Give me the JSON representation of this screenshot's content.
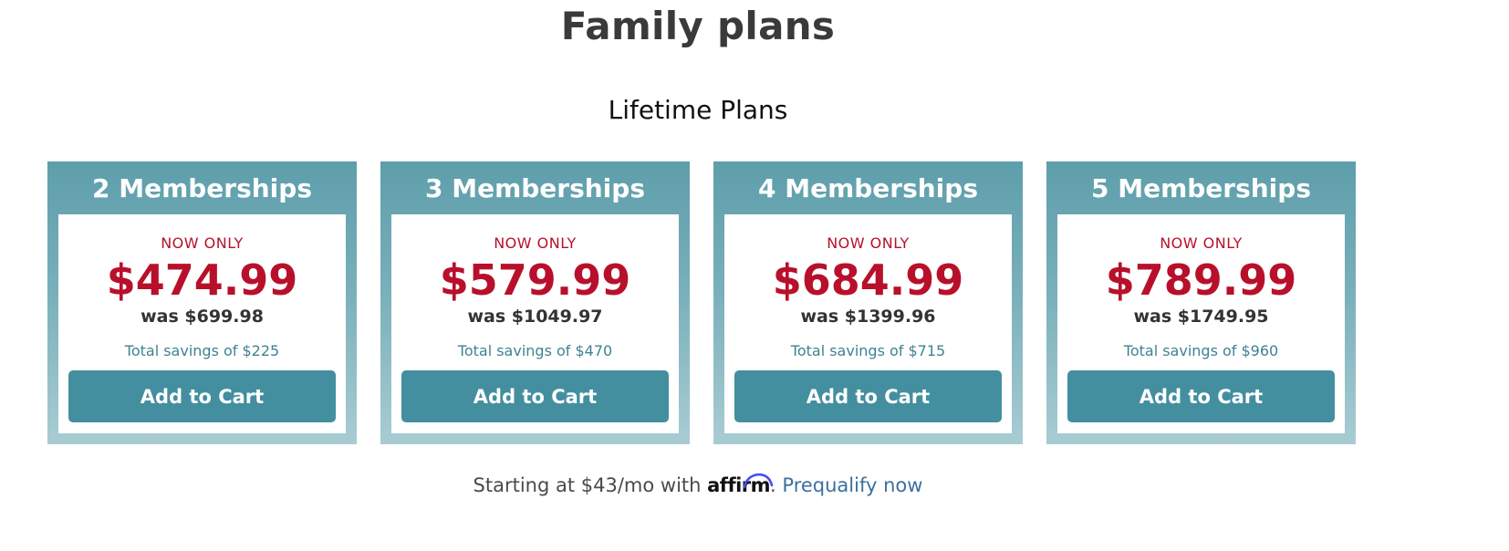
{
  "page": {
    "title": "Family plans",
    "section_title": "Lifetime Plans"
  },
  "plans": [
    {
      "title": "2 Memberships",
      "promo": "NOW ONLY",
      "price": "$474.99",
      "was": "was $699.98",
      "savings": "Total savings of $225",
      "button": "Add to Cart"
    },
    {
      "title": "3 Memberships",
      "promo": "NOW ONLY",
      "price": "$579.99",
      "was": "was $1049.97",
      "savings": "Total savings of $470",
      "button": "Add to Cart"
    },
    {
      "title": "4 Memberships",
      "promo": "NOW ONLY",
      "price": "$684.99",
      "was": "was $1399.96",
      "savings": "Total savings of $715",
      "button": "Add to Cart"
    },
    {
      "title": "5 Memberships",
      "promo": "NOW ONLY",
      "price": "$789.99",
      "was": "was $1749.95",
      "savings": "Total savings of $960",
      "button": "Add to Cart"
    }
  ],
  "financing": {
    "prefix": "Starting at $43/mo with ",
    "brand": "affirm",
    "separator": ".",
    "link": "Prequalify now"
  },
  "colors": {
    "card_header": "#5e9eab",
    "button": "#448f9f",
    "price": "#b8102b",
    "savings": "#3f8293",
    "link": "#3d6f9f"
  },
  "icons": {
    "affirm_logo": "affirm-logo-icon"
  }
}
